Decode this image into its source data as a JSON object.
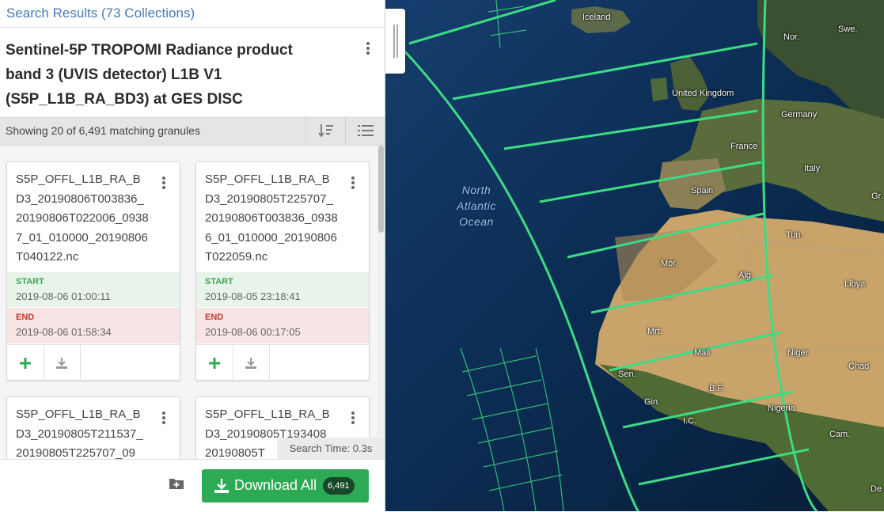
{
  "search": {
    "header": "Search Results (73 Collections)"
  },
  "collection": {
    "title": "Sentinel-5P TROPOMI Radiance product band 3 (UVIS detector) L1B V1 (S5P_L1B_RA_BD3) at GES DISC"
  },
  "granules": {
    "count_text": "Showing 20 of 6,491 matching granules",
    "start_label": "START",
    "end_label": "END",
    "items": [
      {
        "name": "S5P_OFFL_L1B_RA_BD3_20190806T003836_20190806T022006_09387_01_010000_20190806T040122.nc",
        "start": "2019-08-06 01:00:11",
        "end": "2019-08-06 01:58:34"
      },
      {
        "name": "S5P_OFFL_L1B_RA_BD3_20190805T225707_20190806T003836_09386_01_010000_20190806T022059.nc",
        "start": "2019-08-05 23:18:41",
        "end": "2019-08-06 00:17:05"
      },
      {
        "name": "S5P_OFFL_L1B_RA_BD3_20190805T211537_20190805T225707_09"
      },
      {
        "name": "S5P_OFFL_L1B_RA_BD3_20190805T193408_20190805T"
      }
    ]
  },
  "footer": {
    "search_time": "Search Time: 0.3s",
    "download_label": "Download All",
    "download_count": "6,491"
  },
  "map": {
    "ocean_line1": "North",
    "ocean_line2": "Atlantic",
    "ocean_line3": "Ocean",
    "labels": [
      "Iceland",
      "Nor.",
      "Swe.",
      "United Kingdom",
      "Germany",
      "France",
      "Italy",
      "Spain",
      "Gr.",
      "Tun.",
      "Mor.",
      "Alg.",
      "Libya",
      "Mrt.",
      "Mali",
      "Niger",
      "Chad",
      "Sen.",
      "B.F.",
      "Gin.",
      "I.C.",
      "Nigeria",
      "Cam.",
      "De"
    ]
  },
  "colors": {
    "accent_green": "#2daa54",
    "swath_green": "#3ddc84",
    "link_blue": "#4a7ab4"
  }
}
